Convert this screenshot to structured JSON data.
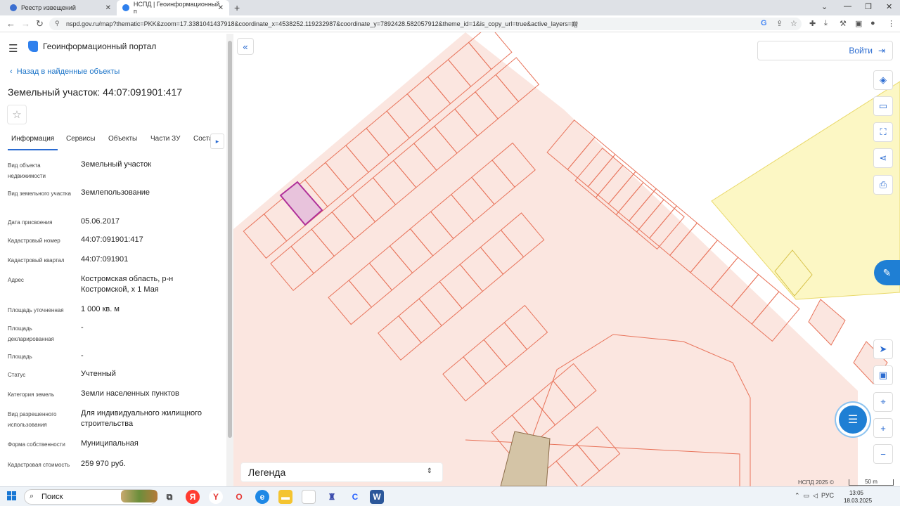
{
  "browser": {
    "tabs": [
      {
        "title": "Реестр извещений",
        "active": false
      },
      {
        "title": "НСПД | Геоинформационный п",
        "active": true
      }
    ],
    "url": "nspd.gov.ru/map?thematic=PKK&zoom=17.3381041437918&coordinate_x=4538252.119232987&coordinate_y=7892428.582057912&theme_id=1&is_copy_url=true&active_layers=",
    "url_tail": "䁬"
  },
  "panel": {
    "portal_title": "Геоинформационный портал",
    "back_label": "Назад в найденные объекты",
    "title": "Земельный участок: 44:07:091901:417",
    "tabs": [
      "Информация",
      "Сервисы",
      "Объекты",
      "Части ЗУ",
      "Соста"
    ],
    "active_tab": "Информация",
    "fields": [
      {
        "label": "Вид объекта недвижимости",
        "value": "Земельный участок"
      },
      {
        "label": "Вид земельного участка",
        "value": "Землепользование"
      },
      {
        "label": "Дата присвоения",
        "value": "05.06.2017"
      },
      {
        "label": "Кадастровый номер",
        "value": "44:07:091901:417"
      },
      {
        "label": "Кадастровый квартал",
        "value": "44:07:091901"
      },
      {
        "label": "Адрес",
        "value": "Костромская область, р-н Костромской, х 1 Мая"
      },
      {
        "label": "Площадь уточненная",
        "value": "1 000 кв. м"
      },
      {
        "label": "Площадь декларированная",
        "value": "-"
      },
      {
        "label": "Площадь",
        "value": "-"
      },
      {
        "label": "Статус",
        "value": "Учтенный"
      },
      {
        "label": "Категория земель",
        "value": "Земли населенных пунктов"
      },
      {
        "label": "Вид разрешенного использования",
        "value": "Для индивидуального жилищного строительства"
      },
      {
        "label": "Форма собственности",
        "value": "Муниципальная"
      },
      {
        "label": "Кадастровая стоимость",
        "value": "259 970 руб."
      }
    ]
  },
  "map": {
    "login_label": "Войти",
    "legend_label": "Легенда",
    "attribution": "НСПД 2025 ©",
    "scale_label": "50 m",
    "colors": {
      "parcel_fill": "#fbe6e0",
      "parcel_stroke": "#e8735a",
      "selected_fill": "#e8c3dc",
      "selected_stroke": "#b0309a",
      "yellow_zone": "#fcf7c4",
      "building": "#d4c4a6",
      "accent": "#1f7fd4"
    },
    "tools": [
      "layers-icon",
      "ruler-icon",
      "select-area-icon",
      "share-icon",
      "print-icon"
    ],
    "bottom_tools": [
      "locate-icon",
      "minimap-icon",
      "geo-search-icon",
      "zoom-in-icon",
      "zoom-out-icon"
    ]
  },
  "taskbar": {
    "search_label": "Поиск",
    "language": "РУС",
    "time": "13:05",
    "date": "18.03.2025"
  }
}
